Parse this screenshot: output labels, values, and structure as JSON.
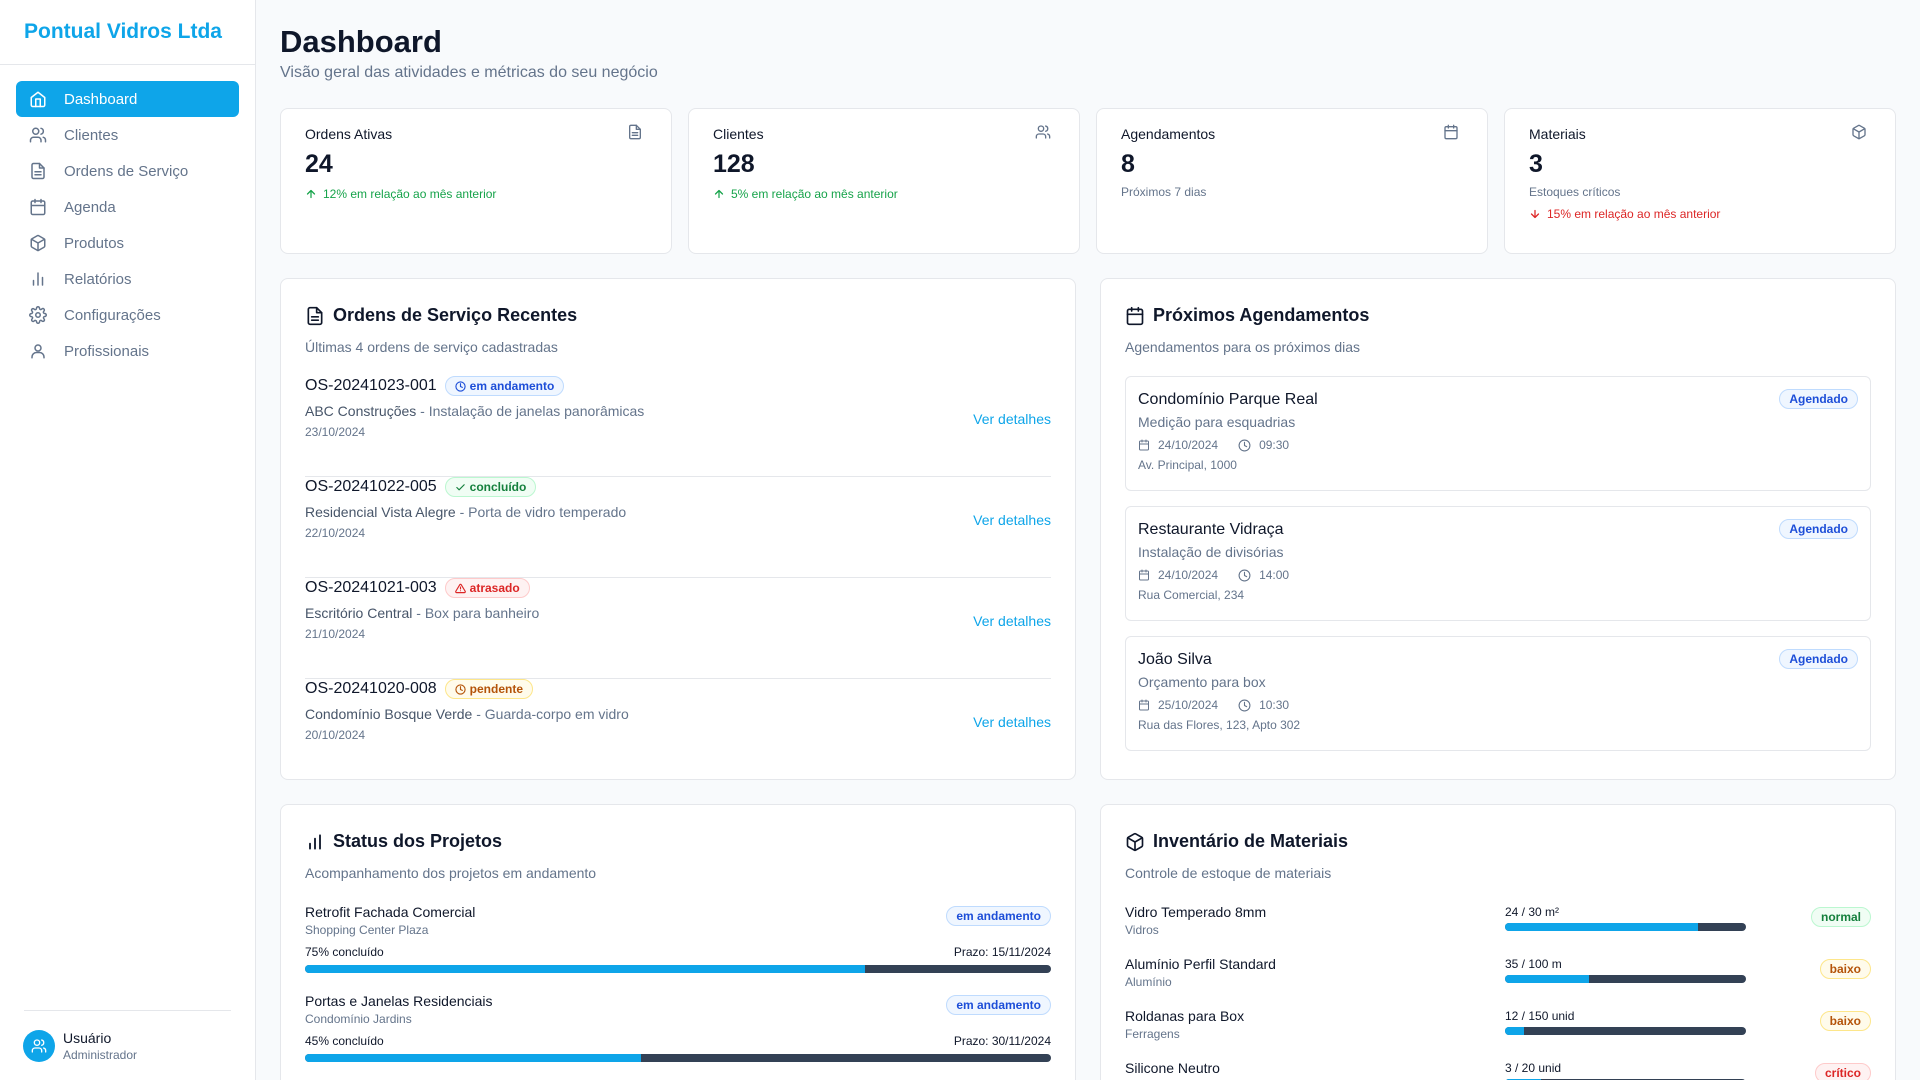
{
  "brand": "Pontual Vidros Ltda",
  "nav": [
    {
      "label": "Dashboard",
      "icon": "home-icon",
      "active": true
    },
    {
      "label": "Clientes",
      "icon": "users-icon"
    },
    {
      "label": "Ordens de Serviço",
      "icon": "file-icon"
    },
    {
      "label": "Agenda",
      "icon": "calendar-icon"
    },
    {
      "label": "Produtos",
      "icon": "box-icon"
    },
    {
      "label": "Relatórios",
      "icon": "chart-icon"
    },
    {
      "label": "Configurações",
      "icon": "gear-icon"
    },
    {
      "label": "Profissionais",
      "icon": "user-icon"
    }
  ],
  "user": {
    "name": "Usuário",
    "role": "Administrador"
  },
  "header": {
    "title": "Dashboard",
    "subtitle": "Visão geral das atividades e métricas do seu negócio"
  },
  "stats": [
    {
      "title": "Ordens Ativas",
      "value": "24",
      "trend": "12% em relação ao mês anterior",
      "icon": "file-icon"
    },
    {
      "title": "Clientes",
      "value": "128",
      "trend": "5% em relação ao mês anterior",
      "icon": "users-icon"
    },
    {
      "title": "Agendamentos",
      "value": "8",
      "note": "Próximos 7 dias",
      "icon": "calendar-icon"
    },
    {
      "title": "Materiais",
      "value": "3",
      "note": "Estoques críticos",
      "trend": "15% em relação ao mês anterior",
      "icon": "box-icon"
    }
  ],
  "orders": {
    "title": "Ordens de Serviço Recentes",
    "subtitle": "Últimas 4 ordens de serviço cadastradas",
    "link_label": "Ver detalhes",
    "items": [
      {
        "code": "OS-20241023-001",
        "status": "em andamento",
        "client": "ABC Construções",
        "desc": " - Instalação de janelas panorâmicas",
        "date": "23/10/2024"
      },
      {
        "code": "OS-20241022-005",
        "status": "concluído",
        "client": "Residencial Vista Alegre",
        "desc": " - Porta de vidro temperado",
        "date": "22/10/2024"
      },
      {
        "code": "OS-20241021-003",
        "status": "atrasado",
        "client": "Escritório Central",
        "desc": " - Box para banheiro",
        "date": "21/10/2024"
      },
      {
        "code": "OS-20241020-008",
        "status": "pendente",
        "client": "Condomínio Bosque Verde",
        "desc": " - Guarda-corpo em vidro",
        "date": "20/10/2024"
      }
    ]
  },
  "appointments": {
    "title": "Próximos Agendamentos",
    "subtitle": "Agendamentos para os próximos dias",
    "items": [
      {
        "name": "Condomínio Parque Real",
        "desc": "Medição para esquadrias",
        "date": "24/10/2024",
        "time": "09:30",
        "address": "Av. Principal, 1000",
        "status": "Agendado"
      },
      {
        "name": "Restaurante Vidraça",
        "desc": "Instalação de divisórias",
        "date": "24/10/2024",
        "time": "14:00",
        "address": "Rua Comercial, 234",
        "status": "Agendado"
      },
      {
        "name": "João Silva",
        "desc": "Orçamento para box",
        "date": "25/10/2024",
        "time": "10:30",
        "address": "Rua das Flores, 123, Apto 302",
        "status": "Agendado"
      }
    ]
  },
  "projects": {
    "title": "Status dos Projetos",
    "subtitle": "Acompanhamento dos projetos em andamento",
    "items": [
      {
        "name": "Retrofit Fachada Comercial",
        "client": "Shopping Center Plaza",
        "status": "em andamento",
        "progress_label": "75% concluído",
        "progress": 0.75,
        "deadline": "Prazo: 15/11/2024"
      },
      {
        "name": "Portas e Janelas Residenciais",
        "client": "Condomínio Jardins",
        "status": "em andamento",
        "progress_label": "45% concluído",
        "progress": 0.45,
        "deadline": "Prazo: 30/11/2024"
      }
    ]
  },
  "materials": {
    "title": "Inventário de Materiais",
    "subtitle": "Controle de estoque de materiais",
    "items": [
      {
        "name": "Vidro Temperado 8mm",
        "category": "Vidros",
        "qty": "24 / 30 m²",
        "level": 0.8,
        "status": "normal"
      },
      {
        "name": "Alumínio Perfil Standard",
        "category": "Alumínio",
        "qty": "35 / 100 m",
        "level": 0.35,
        "status": "baixo"
      },
      {
        "name": "Roldanas para Box",
        "category": "Ferragens",
        "qty": "12 / 150 unid",
        "level": 0.08,
        "status": "baixo"
      },
      {
        "name": "Silicone Neutro",
        "category": "",
        "qty": "3 / 20 unid",
        "level": 0.15,
        "status": "crítico"
      }
    ]
  },
  "colors": {
    "accent": "#0ea5e9",
    "up": "#16a34a",
    "down": "#dc2626"
  }
}
